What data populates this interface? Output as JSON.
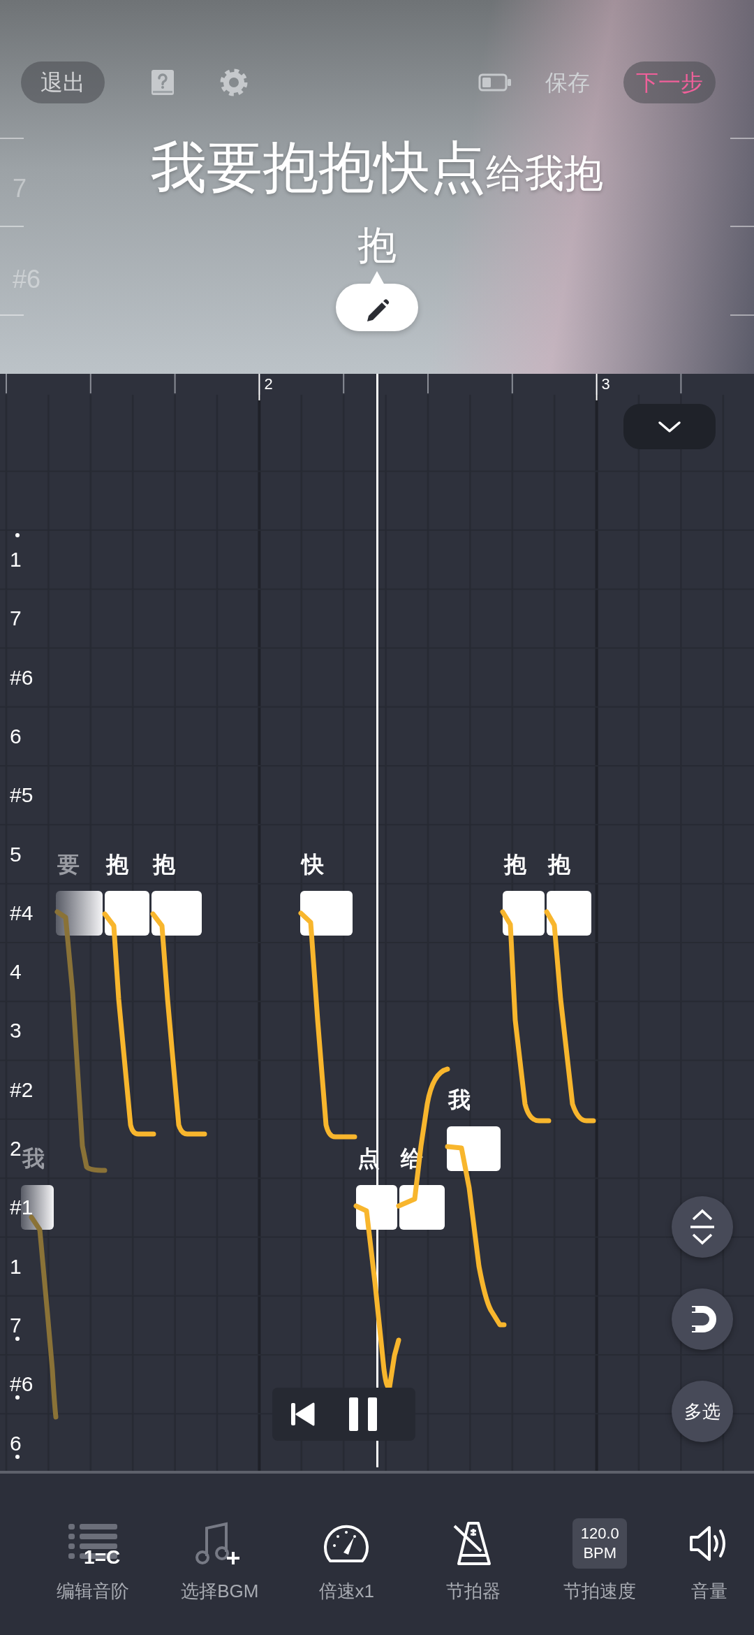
{
  "header": {
    "exit_button": "退出",
    "save_button": "保存",
    "next_button": "下一步",
    "scale_labels": [
      "7",
      "#6"
    ],
    "lyrics": {
      "lead": "我要抱抱快点",
      "tail": "给我抱",
      "wrap": "抱"
    }
  },
  "ruler": {
    "bar_numbers": [
      "2",
      "3"
    ]
  },
  "pitch_rows": [
    {
      "label": "1",
      "dot_above": true,
      "dot_below": false
    },
    {
      "label": "7",
      "dot_above": false,
      "dot_below": false
    },
    {
      "label": "#6",
      "dot_above": false,
      "dot_below": false
    },
    {
      "label": "6",
      "dot_above": false,
      "dot_below": false
    },
    {
      "label": "#5",
      "dot_above": false,
      "dot_below": false
    },
    {
      "label": "5",
      "dot_above": false,
      "dot_below": false
    },
    {
      "label": "#4",
      "dot_above": false,
      "dot_below": false,
      "notes": [
        {
          "lyric": "要",
          "dimmed": true
        },
        {
          "lyric": "抱",
          "dimmed": false
        },
        {
          "lyric": "抱",
          "dimmed": false
        },
        {
          "lyric": "快",
          "dimmed": false
        },
        {
          "lyric": "抱",
          "dimmed": false
        },
        {
          "lyric": "抱",
          "dimmed": false
        }
      ]
    },
    {
      "label": "4",
      "dot_above": false,
      "dot_below": false
    },
    {
      "label": "3",
      "dot_above": false,
      "dot_below": false
    },
    {
      "label": "#2",
      "dot_above": false,
      "dot_below": false
    },
    {
      "label": "2",
      "dot_above": false,
      "dot_below": false,
      "notes": [
        {
          "lyric": "我",
          "dimmed": false
        }
      ]
    },
    {
      "label": "#1",
      "dot_above": false,
      "dot_below": false,
      "notes": [
        {
          "lyric": "我",
          "dimmed": true
        },
        {
          "lyric": "点",
          "dimmed": false
        },
        {
          "lyric": "给",
          "dimmed": false
        }
      ]
    },
    {
      "label": "1",
      "dot_above": false,
      "dot_below": false
    },
    {
      "label": "7",
      "dot_above": false,
      "dot_below": true
    },
    {
      "label": "#6",
      "dot_above": false,
      "dot_below": true
    },
    {
      "label": "6",
      "dot_above": false,
      "dot_below": true
    }
  ],
  "multi_select_button": "多选",
  "toolbar": [
    {
      "kind": "scale",
      "label": "编辑音阶",
      "badge": "1=C"
    },
    {
      "kind": "bgm",
      "label": "选择BGM"
    },
    {
      "kind": "speed",
      "label": "倍速x1"
    },
    {
      "kind": "metronome",
      "label": "节拍器"
    },
    {
      "kind": "tempo",
      "label": "节拍速度",
      "value": "120.0",
      "unit": "BPM"
    },
    {
      "kind": "volume",
      "label": "音量"
    }
  ]
}
